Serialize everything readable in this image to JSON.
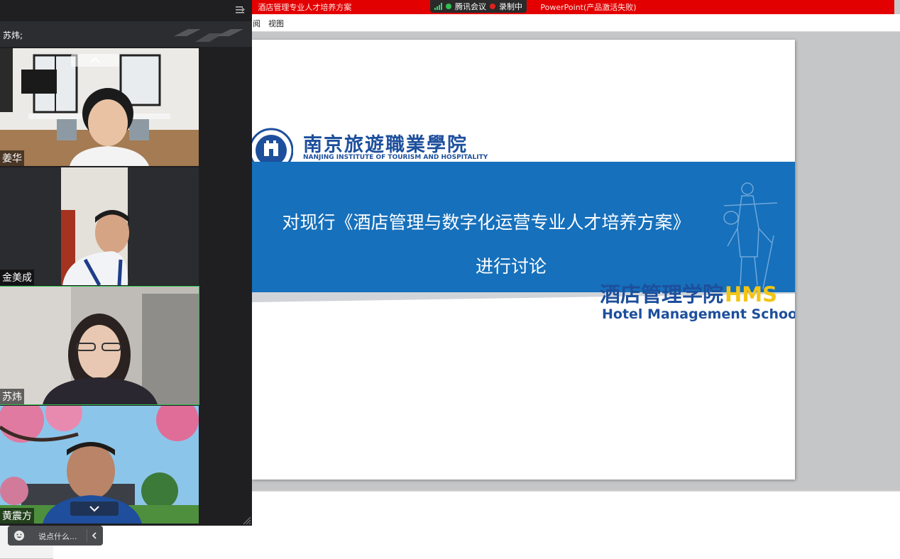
{
  "window": {
    "title_left": "酒店管理专业人才培养方案",
    "title_right": "PowerPoint(产品激活失败)"
  },
  "meeting": {
    "app_name": "腾讯会议",
    "recording": "录制中"
  },
  "ribbon": {
    "tab_partial": "阅",
    "tab_view": "视图"
  },
  "slide": {
    "school_name_cn": "南京旅遊職業學院",
    "school_name_en": "NANJING INSTITUTE OF TOURISM AND HOSPITALITY",
    "title_line1": "对现行《酒店管理与数字化运营专业人才培养方案》",
    "title_line2": "进行讨论",
    "dept_cn": "酒店管理学院",
    "dept_abbr": "HMS",
    "dept_en": "Hotel Management School"
  },
  "video_panel": {
    "speaking": "苏炜;",
    "participants": [
      {
        "name": "姜华"
      },
      {
        "name": "金美成"
      },
      {
        "name": "苏炜"
      },
      {
        "name": "黄震方"
      }
    ]
  },
  "chat": {
    "placeholder": "说点什么..."
  },
  "colors": {
    "title_bar": "#e30000",
    "banner_blue": "#1670bb",
    "school_blue": "#1d4f9c",
    "hms_yellow": "#f2c515",
    "active_speaker": "#2fbf50"
  }
}
